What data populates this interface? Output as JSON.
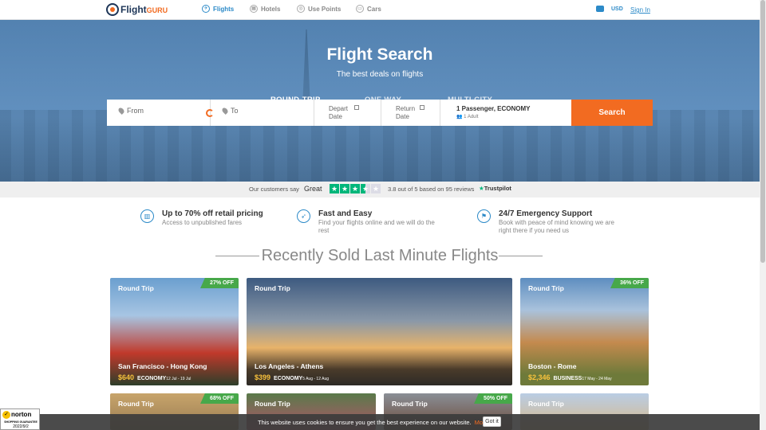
{
  "nav": {
    "logo_main": "Flight",
    "logo_accent": "GURU",
    "items": [
      {
        "label": "Flights",
        "icon": "plane-icon"
      },
      {
        "label": "Hotels",
        "icon": "hotel-icon"
      },
      {
        "label": "Use Points",
        "icon": "points-icon"
      },
      {
        "label": "Cars",
        "icon": "car-icon"
      }
    ],
    "currency": "USD",
    "signin": "Sign In"
  },
  "hero": {
    "title": "Flight Search",
    "subtitle": "The best deals on flights",
    "trip_tabs": [
      "ROUND-TRIP",
      "ONE WAY",
      "MULTI-CITY"
    ],
    "active_tab": "ROUND-TRIP",
    "from_placeholder": "From",
    "to_placeholder": "To",
    "depart_label": "Depart",
    "depart_label2": "Date",
    "return_label": "Return",
    "return_label2": "Date",
    "passengers": "1 Passenger, ECONOMY",
    "passengers_sub": "1 Adult",
    "search_button": "Search"
  },
  "trust": {
    "say": "Our customers say",
    "word": "Great",
    "rating": 3.8,
    "score_text": "3.8 out of 5 based on 95 reviews",
    "brand": "Trustpilot"
  },
  "features": [
    {
      "title": "Up to 70% off retail pricing",
      "desc": "Access to unpublished fares",
      "icon": "discount-icon"
    },
    {
      "title": "Fast and Easy",
      "desc": "Find your flights online and we will do the rest",
      "icon": "rocket-icon"
    },
    {
      "title": "24/7 Emergency Support",
      "desc": "Book with peace of mind knowing we are right there if you need us",
      "icon": "flag-icon"
    }
  ],
  "section_title": "Recently Sold Last Minute Flights",
  "cards": [
    {
      "trip": "Round Trip",
      "off": "27% OFF",
      "route": "San Francisco - Hong Kong",
      "price": "$640",
      "class": "ECONOMY",
      "dates": "12 Jul - 19 Jul"
    },
    {
      "trip": "Round Trip",
      "off": "",
      "route": "Los Angeles - Athens",
      "price": "$399",
      "class": "ECONOMY",
      "dates": "5 Aug - 12 Aug"
    },
    {
      "trip": "Round Trip",
      "off": "36% OFF",
      "route": "Boston - Rome",
      "price": "$2,346",
      "class": "BUSINESS",
      "dates": "17 May - 24 May"
    },
    {
      "trip": "Round Trip",
      "off": "68% OFF"
    },
    {
      "trip": "Round Trip",
      "off": ""
    },
    {
      "trip": "Round Trip",
      "off": "50% OFF"
    },
    {
      "trip": "Round Trip",
      "off": ""
    }
  ],
  "cookie": {
    "text": "This website uses cookies to ensure you get the best experience on our website.",
    "more": "More info",
    "button": "Got it"
  },
  "norton": {
    "name": "norton",
    "sub": "SHOPPING GUARANTEE",
    "date": "2022/9/2"
  },
  "colors": {
    "accent": "#f26b21",
    "link": "#2c8ac8",
    "trustpilot": "#00b67a",
    "discount": "#47a84a",
    "price": "#f9c23c"
  }
}
